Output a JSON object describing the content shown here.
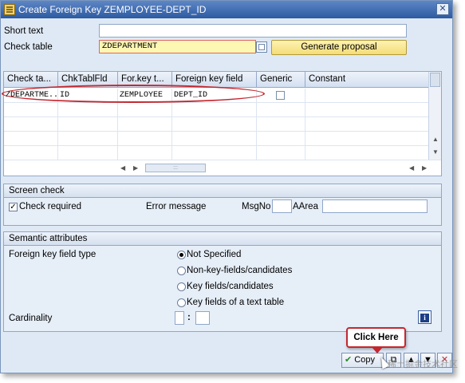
{
  "window": {
    "title": "Create Foreign Key ZEMPLOYEE-DEPT_ID"
  },
  "fields": {
    "short_text_label": "Short text",
    "short_text_value": "",
    "check_table_label": "Check table",
    "check_table_value": "ZDEPARTMENT",
    "generate_button": "Generate proposal"
  },
  "table": {
    "columns": [
      "Check ta...",
      "ChkTablFld",
      "For.key t...",
      "Foreign key field",
      "Generic",
      "Constant"
    ],
    "rows": [
      {
        "check_table": "ZDEPARTME...",
        "chk_field": "ID",
        "for_key_table": "ZEMPLOYEE",
        "fk_field": "DEPT_ID",
        "generic": false,
        "constant": ""
      }
    ]
  },
  "screen_check": {
    "title": "Screen check",
    "check_required_label": "Check required",
    "check_required": true,
    "error_message_label": "Error message",
    "msgno_label": "MsgNo",
    "msgno_value": "",
    "aarea_label": "AArea",
    "aarea_value": ""
  },
  "semantic": {
    "title": "Semantic attributes",
    "fk_type_label": "Foreign key field type",
    "options": [
      "Not Specified",
      "Non-key-fields/candidates",
      "Key fields/candidates",
      "Key fields of a text table"
    ],
    "selected_index": 0,
    "cardinality_label": "Cardinality",
    "cardinality_left": "",
    "cardinality_sep": ":",
    "cardinality_right": ""
  },
  "footer": {
    "copy_label": "Copy",
    "callout": "Click Here",
    "watermark": "稀土掘金技术社区"
  },
  "colors": {
    "accent_red": "#c3282f",
    "title_bar": "#2d5aa1"
  },
  "icons": [
    "window-icon",
    "close-icon",
    "display-icon",
    "checkmark-icon",
    "copy-icon",
    "up-icon",
    "down-icon",
    "cancel-icon",
    "info-icon"
  ]
}
